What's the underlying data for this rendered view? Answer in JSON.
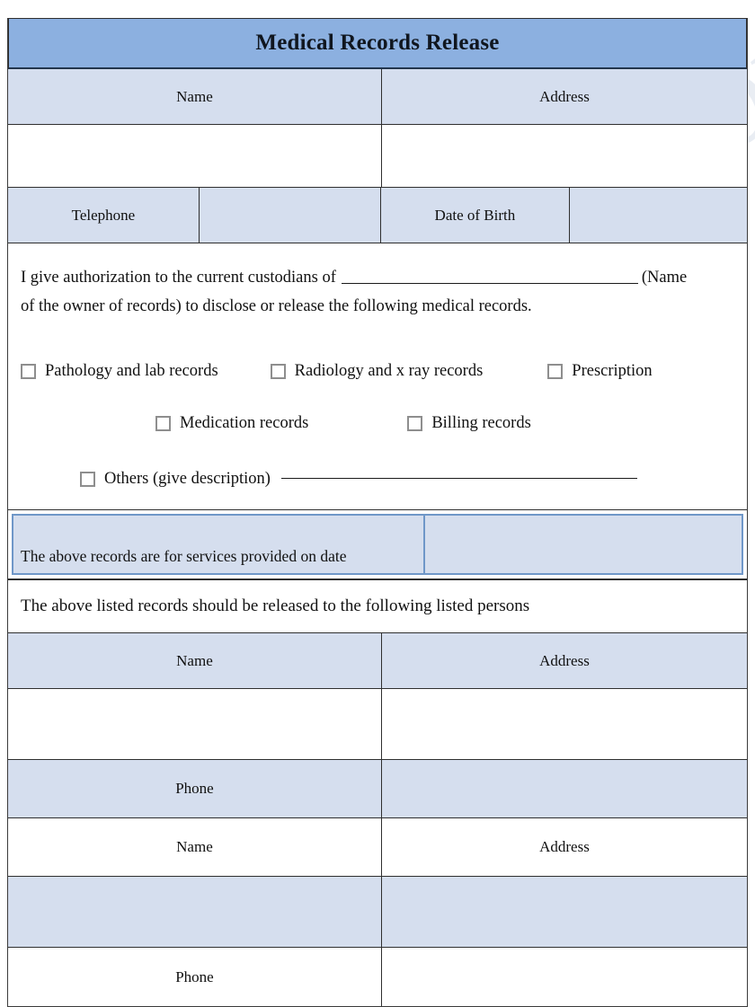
{
  "watermark": {
    "text": "editableforms.com"
  },
  "header": {
    "title": "Medical Records Release"
  },
  "patient_table": {
    "columns": {
      "name": "Name",
      "address": "Address"
    },
    "value_name": "",
    "value_address": "",
    "telephone_label": "Telephone",
    "telephone_value": "",
    "dob_label": "Date of Birth",
    "dob_value": ""
  },
  "authorization": {
    "line1_before": "I give authorization to the current custodians of",
    "line1_blank_value": "",
    "line1_after": "(Name",
    "line2": "of the owner of records) to disclose or release the following medical records."
  },
  "record_types": {
    "row1": [
      {
        "label": "Pathology and lab records",
        "checked": false
      },
      {
        "label": "Radiology and x ray records",
        "checked": false
      },
      {
        "label": "Prescription",
        "checked": false
      }
    ],
    "row2": [
      {
        "label": "Medication records",
        "checked": false
      },
      {
        "label": "Billing records",
        "checked": false
      }
    ],
    "row3": [
      {
        "label": "Others (give description)",
        "checked": false,
        "description_value": ""
      }
    ]
  },
  "service_date": {
    "label": "The above records are for services provided on date",
    "value": ""
  },
  "release_statement": {
    "text": "The above listed records should be released to the following listed persons"
  },
  "recipients": {
    "columns": {
      "name": "Name",
      "address": "Address"
    },
    "phone_label": "Phone",
    "person1": {
      "name_value": "",
      "address_value": "",
      "phone_value": ""
    },
    "person2": {
      "name_value": "",
      "address_value": "",
      "phone_value": ""
    }
  },
  "colors": {
    "title_bar": "#8cb0e0",
    "cell_fill": "#d5deee",
    "border": "#2f2f2f",
    "accent_border": "#6f97c8",
    "checkbox_border": "#8e8e8e",
    "watermark": "#b9c6da"
  }
}
